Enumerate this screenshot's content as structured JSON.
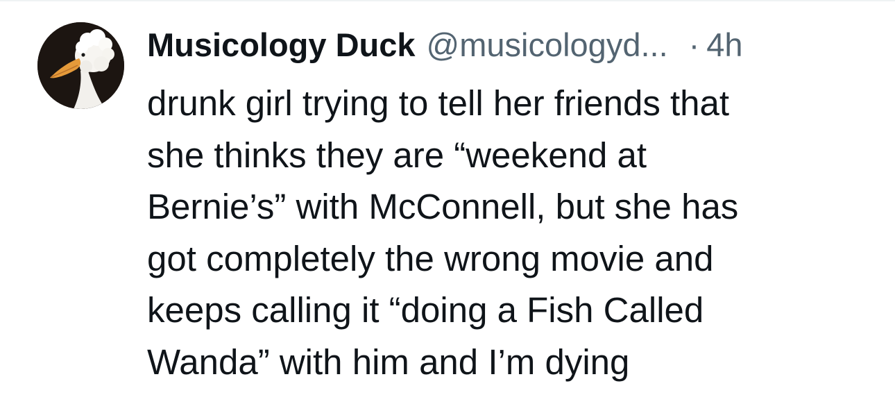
{
  "post": {
    "author": {
      "display_name": "Musicology Duck",
      "handle": "@musicologyd...",
      "avatar_icon": "white-duck-avatar"
    },
    "separator": "·",
    "timestamp": "4h",
    "text_lines": [
      "drunk girl trying to tell her friends that",
      "she thinks they are “weekend at",
      "Bernie’s” with McConnell, but she has",
      "got completely the wrong movie and",
      "keeps calling it “doing a Fish Called",
      "Wanda” with him and I’m dying"
    ]
  },
  "colors": {
    "primary_text": "#0f1419",
    "secondary_text": "#536471",
    "divider": "#eff3f4",
    "background": "#ffffff"
  }
}
